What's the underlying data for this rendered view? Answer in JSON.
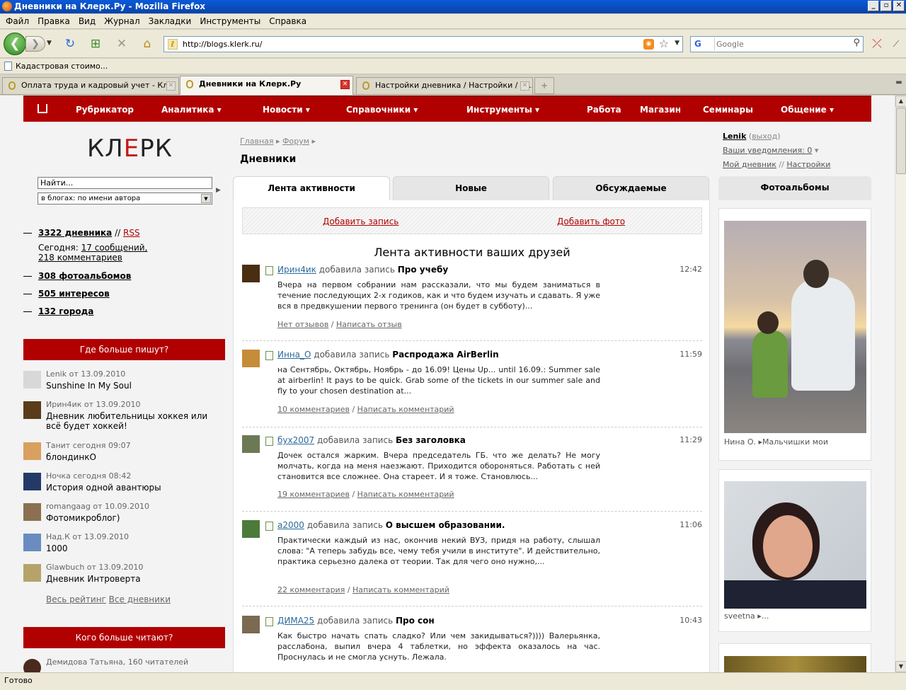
{
  "window": {
    "title": "Дневники на Клерк.Ру - Mozilla Firefox",
    "buttons": [
      "_",
      "▫",
      "✕"
    ]
  },
  "menu": [
    "Файл",
    "Правка",
    "Вид",
    "Журнал",
    "Закладки",
    "Инструменты",
    "Справка"
  ],
  "address": {
    "url": "http://blogs.klerk.ru/"
  },
  "search": {
    "placeholder": "Google",
    "engine": "G"
  },
  "bookmarks": [
    {
      "label": "Кадастровая стоимо..."
    }
  ],
  "tabs": [
    {
      "label": "Оплата труда и кадровый учет - Кл...",
      "active": false
    },
    {
      "label": "Дневники на Клерк.Ру",
      "active": true
    },
    {
      "label": "Настройки дневника / Настройки / Д...",
      "active": false
    }
  ],
  "status": "Готово",
  "site": {
    "menu": [
      "Рубрикатор",
      "Аналитика ▾",
      "Новости ▾",
      "Справочники ▾",
      "Инструменты ▾",
      "Работа",
      "Магазин",
      "Семинары",
      "Общение ▾"
    ],
    "logo": {
      "left": "КЛ",
      "mid": "Е",
      "right": "РК"
    },
    "search_value": "Найти...",
    "search_scope": "в блогах: по имени автора",
    "stats": {
      "diaries": "3322 дневника",
      "sep": "//",
      "rss": "RSS",
      "today_label": "Сегодня:",
      "today_msgs": "17 сообщений,",
      "today_comments": "218 комментариев",
      "albums": "308 фотоальбомов",
      "interests": "505 интересов",
      "cities": "132 города"
    },
    "popular_title": "Где больше пишут?",
    "popular": [
      {
        "meta": "Lenik от 13.09.2010",
        "title": "Sunshine In My Soul",
        "color": "#d8d8d8"
      },
      {
        "meta": "Ирин4ик от 13.09.2010",
        "title": "Дневник любительницы хоккея или всё будет хоккей!",
        "color": "#5a3b1a"
      },
      {
        "meta": "Танит сегодня 09:07",
        "title": "блондинкО",
        "color": "#d9a060"
      },
      {
        "meta": "Ночка сегодня 08:42",
        "title": "История одной авантюры",
        "color": "#233a66"
      },
      {
        "meta": "romangaag от 10.09.2010",
        "title": "Фотомикроблог)",
        "color": "#8a7050"
      },
      {
        "meta": "Над.К от 13.09.2010",
        "title": "1000",
        "color": "#6a8cc0"
      },
      {
        "meta": "Glawbuch от 13.09.2010",
        "title": "Дневник Интроверта",
        "color": "#b6a36a"
      }
    ],
    "rating_link": "Весь рейтинг",
    "all_link": "Все дневники",
    "read_title": "Кого больше читают?",
    "read_first": "Демидова Татьяна, 160 читателей",
    "crumbs": {
      "home": "Главная",
      "forum": "Форум"
    },
    "page_title": "Дневники",
    "content_tabs": [
      "Лента активности",
      "Новые",
      "Обсуждаемые"
    ],
    "add_post": "Добавить запись",
    "add_photo": "Добавить фото",
    "feed_title": "Лента активности ваших друзей",
    "posts": [
      {
        "author": "Ирин4ик",
        "verb": "добавила запись",
        "title": "Про учебу",
        "time": "12:42",
        "body": "Вчера на первом собрании нам рассказали, что мы будем заниматься в течение последующих 2-х годиков, как и что будем изучать и сдавать. Я уже вся в предвкушении первого тренинга (он будет в субботу)...",
        "links": [
          "Нет отзывов",
          "Написать отзыв"
        ],
        "color": "#4a2e12"
      },
      {
        "author": "Инна_О",
        "verb": "добавила запись",
        "title": "Распродажа AirBerlin",
        "time": "11:59",
        "body": "на Сентябрь, Октябрь, Ноябрь - до 16.09! Цены Up... until 16.09.: Summer sale at airberlin! It pays to be quick. Grab some of the tickets in our summer sale and fly to your chosen destination at...",
        "links": [
          "10 комментариев",
          "Написать комментарий"
        ],
        "color": "#c58c3a"
      },
      {
        "author": "бух2007",
        "verb": "добавила запись",
        "title": "Без заголовка",
        "time": "11:29",
        "body": "Дочек остался жарким. Вчера председатель ГБ. что же делать? Не могу молчать, когда на меня наезжают. Приходится обороняться. Работать с ней становится все сложнее. Она стареет. И я тоже. Становлюсь...",
        "links": [
          "19 комментариев",
          "Написать комментарий"
        ],
        "color": "#6b7a54"
      },
      {
        "author": "a2000",
        "verb": "добавила запись",
        "title": "О высшем образовании.",
        "time": "11:06",
        "body": "Практически каждый из нас, окончив некий ВУЗ, придя на работу, слышал слова: \"А теперь забудь все, чему тебя учили в институте\". И действительно, практика серьезно далека от теории. Так для чего оно нужно,...",
        "links": [
          "22 комментария",
          "Написать комментарий"
        ],
        "color": "#4c7a3a"
      },
      {
        "author": "ДИМА25",
        "verb": "добавила запись",
        "title": "Про сон",
        "time": "10:43",
        "body": "Как быстро начать спать сладко? Или чем закидываться?)))) Валерьянка, расслабона, выпил вчера 4 таблетки, но эффекта оказалось на час. Проснулась и не смогла уснуть. Лежала.",
        "links": [],
        "color": "#7a6a52"
      }
    ],
    "user": {
      "name": "Lenik",
      "logout": "выход",
      "notif": "Ваши уведомления: 0",
      "diary": "Мой дневник",
      "sep": "//",
      "settings": "Настройки"
    },
    "albums_tab": "Фотоальбомы",
    "photos": [
      {
        "author": "Нина О.",
        "album": "Мальчишки мои"
      },
      {
        "author": "sveetna",
        "album": "..."
      }
    ]
  }
}
